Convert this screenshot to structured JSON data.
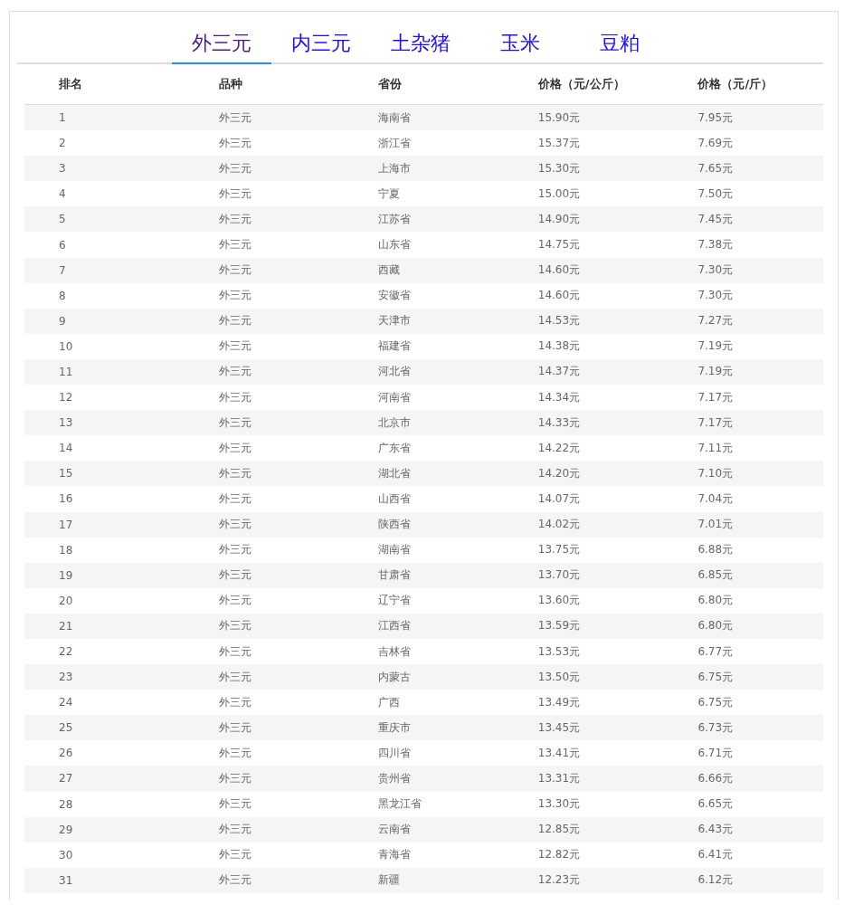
{
  "tabs": [
    {
      "label": "外三元",
      "selected": true
    },
    {
      "label": "内三元",
      "selected": false
    },
    {
      "label": "土杂猪",
      "selected": false
    },
    {
      "label": "玉米",
      "selected": false
    },
    {
      "label": "豆粕",
      "selected": false
    }
  ],
  "table": {
    "columns": [
      "排名",
      "品种",
      "省份",
      "价格（元/公斤）",
      "价格（元/斤）"
    ],
    "rows": [
      [
        "1",
        "外三元",
        "海南省",
        "15.90元",
        "7.95元"
      ],
      [
        "2",
        "外三元",
        "浙江省",
        "15.37元",
        "7.69元"
      ],
      [
        "3",
        "外三元",
        "上海市",
        "15.30元",
        "7.65元"
      ],
      [
        "4",
        "外三元",
        "宁夏",
        "15.00元",
        "7.50元"
      ],
      [
        "5",
        "外三元",
        "江苏省",
        "14.90元",
        "7.45元"
      ],
      [
        "6",
        "外三元",
        "山东省",
        "14.75元",
        "7.38元"
      ],
      [
        "7",
        "外三元",
        "西藏",
        "14.60元",
        "7.30元"
      ],
      [
        "8",
        "外三元",
        "安徽省",
        "14.60元",
        "7.30元"
      ],
      [
        "9",
        "外三元",
        "天津市",
        "14.53元",
        "7.27元"
      ],
      [
        "10",
        "外三元",
        "福建省",
        "14.38元",
        "7.19元"
      ],
      [
        "11",
        "外三元",
        "河北省",
        "14.37元",
        "7.19元"
      ],
      [
        "12",
        "外三元",
        "河南省",
        "14.34元",
        "7.17元"
      ],
      [
        "13",
        "外三元",
        "北京市",
        "14.33元",
        "7.17元"
      ],
      [
        "14",
        "外三元",
        "广东省",
        "14.22元",
        "7.11元"
      ],
      [
        "15",
        "外三元",
        "湖北省",
        "14.20元",
        "7.10元"
      ],
      [
        "16",
        "外三元",
        "山西省",
        "14.07元",
        "7.04元"
      ],
      [
        "17",
        "外三元",
        "陕西省",
        "14.02元",
        "7.01元"
      ],
      [
        "18",
        "外三元",
        "湖南省",
        "13.75元",
        "6.88元"
      ],
      [
        "19",
        "外三元",
        "甘肃省",
        "13.70元",
        "6.85元"
      ],
      [
        "20",
        "外三元",
        "辽宁省",
        "13.60元",
        "6.80元"
      ],
      [
        "21",
        "外三元",
        "江西省",
        "13.59元",
        "6.80元"
      ],
      [
        "22",
        "外三元",
        "吉林省",
        "13.53元",
        "6.77元"
      ],
      [
        "23",
        "外三元",
        "内蒙古",
        "13.50元",
        "6.75元"
      ],
      [
        "24",
        "外三元",
        "广西",
        "13.49元",
        "6.75元"
      ],
      [
        "25",
        "外三元",
        "重庆市",
        "13.45元",
        "6.73元"
      ],
      [
        "26",
        "外三元",
        "四川省",
        "13.41元",
        "6.71元"
      ],
      [
        "27",
        "外三元",
        "贵州省",
        "13.31元",
        "6.66元"
      ],
      [
        "28",
        "外三元",
        "黑龙江省",
        "13.30元",
        "6.65元"
      ],
      [
        "29",
        "外三元",
        "云南省",
        "12.85元",
        "6.43元"
      ],
      [
        "30",
        "外三元",
        "青海省",
        "12.82元",
        "6.41元"
      ],
      [
        "31",
        "外三元",
        "新疆",
        "12.23元",
        "6.12元"
      ]
    ]
  }
}
